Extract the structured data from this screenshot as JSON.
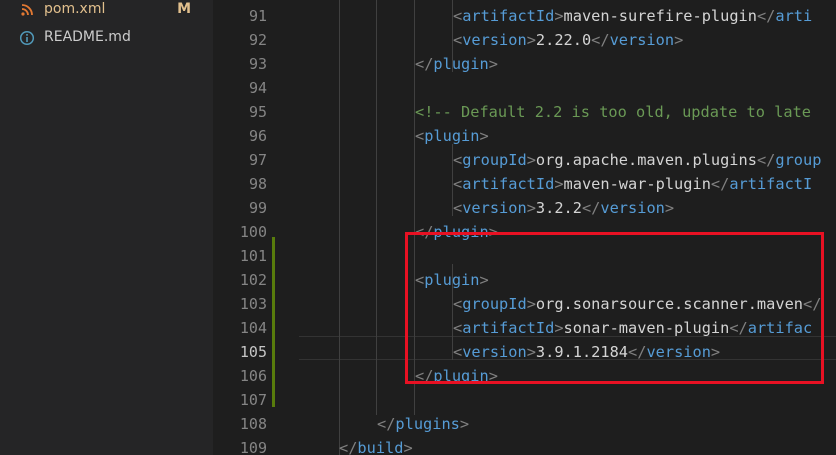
{
  "explorer": {
    "files": [
      {
        "name": "pom.xml",
        "badge": "M",
        "icon": "rss-icon"
      },
      {
        "name": "README.md",
        "badge": "",
        "icon": "info-icon"
      }
    ]
  },
  "editor": {
    "active_line": "105",
    "lines": [
      {
        "num": "91",
        "t1": "<",
        "n1": "artifactId",
        "t2": ">",
        "text": "maven-surefire-plugin",
        "t3": "</",
        "n2": "arti",
        "t4": ""
      },
      {
        "num": "92",
        "t1": "<",
        "n1": "version",
        "t2": ">",
        "text": "2.22.0",
        "t3": "</",
        "n2": "version",
        "t4": ">"
      },
      {
        "num": "93",
        "t1": "</",
        "n1": "plugin",
        "t2": ">"
      },
      {
        "num": "94"
      },
      {
        "num": "95",
        "comment": "<!-- Default 2.2 is too old, update to late"
      },
      {
        "num": "96",
        "t1": "<",
        "n1": "plugin",
        "t2": ">"
      },
      {
        "num": "97",
        "t1": "<",
        "n1": "groupId",
        "t2": ">",
        "text": "org.apache.maven.plugins",
        "t3": "</",
        "n2": "group",
        "t4": ""
      },
      {
        "num": "98",
        "t1": "<",
        "n1": "artifactId",
        "t2": ">",
        "text": "maven-war-plugin",
        "t3": "</",
        "n2": "artifactI",
        "t4": ""
      },
      {
        "num": "99",
        "t1": "<",
        "n1": "version",
        "t2": ">",
        "text": "3.2.2",
        "t3": "</",
        "n2": "version",
        "t4": ">"
      },
      {
        "num": "100",
        "t1": "</",
        "n1": "plugin",
        "t2": ">"
      },
      {
        "num": "101"
      },
      {
        "num": "102",
        "t1": "<",
        "n1": "plugin",
        "t2": ">"
      },
      {
        "num": "103",
        "t1": "<",
        "n1": "groupId",
        "t2": ">",
        "text": "org.sonarsource.scanner.maven",
        "t3": "</",
        "n2": "",
        "t4": ""
      },
      {
        "num": "104",
        "t1": "<",
        "n1": "artifactId",
        "t2": ">",
        "text": "sonar-maven-plugin",
        "t3": "</",
        "n2": "artifac",
        "t4": ""
      },
      {
        "num": "105",
        "t1": "<",
        "n1": "version",
        "t2": ">",
        "text": "3.9.1.2184",
        "t3": "</",
        "n2": "version",
        "t4": ">"
      },
      {
        "num": "106",
        "t1": "</",
        "n1": "plugin",
        "t2": ">"
      },
      {
        "num": "107"
      },
      {
        "num": "108",
        "t1": "</",
        "n1": "plugins",
        "t2": ">"
      },
      {
        "num": "109",
        "t1": "</",
        "n1": "build",
        "t2": ">"
      }
    ]
  },
  "colors": {
    "highlight_box": "#e81123",
    "modified_gutter": "#587c0c",
    "tag": "#569cd6",
    "bracket": "#808080",
    "comment": "#6a9955"
  }
}
